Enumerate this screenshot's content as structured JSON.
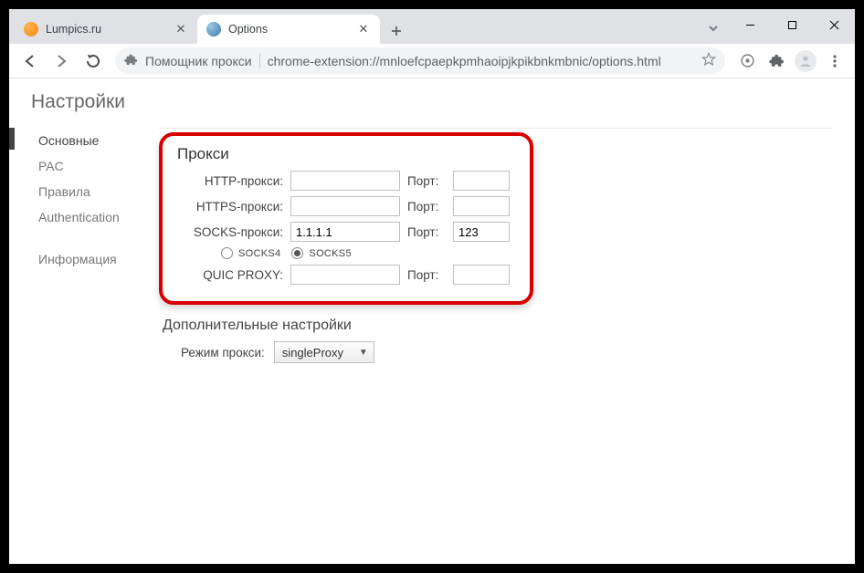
{
  "window": {
    "tabs": [
      {
        "label": "Lumpics.ru",
        "active": false
      },
      {
        "label": "Options",
        "active": true
      }
    ]
  },
  "addressbar": {
    "title": "Помощник прокси",
    "url": "chrome-extension://mnloefcpaepkpmhaoipjkpikbnkmbnic/options.html"
  },
  "page": {
    "title": "Настройки",
    "sidebar": {
      "items": [
        "Основные",
        "PAC",
        "Правила",
        "Authentication"
      ],
      "footer": "Информация",
      "activeIndex": 0
    },
    "proxy": {
      "heading": "Прокси",
      "rows": {
        "http": {
          "label": "HTTP-прокси:",
          "host": "",
          "portLabel": "Порт:",
          "port": ""
        },
        "https": {
          "label": "HTTPS-прокси:",
          "host": "",
          "portLabel": "Порт:",
          "port": ""
        },
        "socks": {
          "label": "SOCKS-прокси:",
          "host": "1.1.1.1",
          "portLabel": "Порт:",
          "port": "123"
        },
        "quic": {
          "label": "QUIC PROXY:",
          "host": "",
          "portLabel": "Порт:",
          "port": ""
        }
      },
      "socks_versions": {
        "socks4": "SOCKS4",
        "socks5": "SOCKS5",
        "selected": "socks5"
      }
    },
    "advanced": {
      "heading": "Дополнительные настройки",
      "modeLabel": "Режим прокси:",
      "modeValue": "singleProxy"
    }
  }
}
